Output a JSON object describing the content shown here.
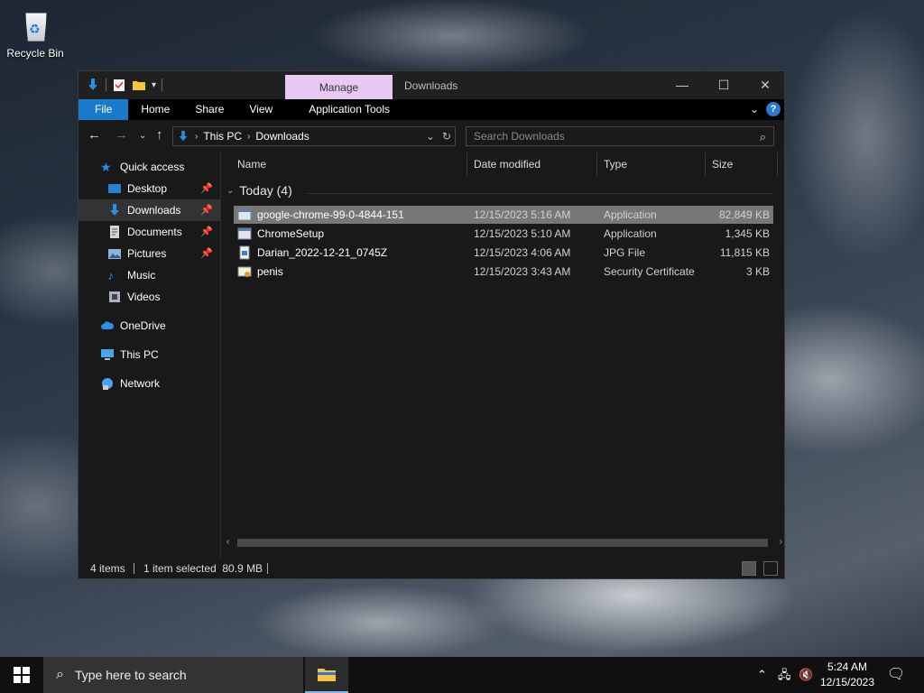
{
  "desktop": {
    "recycle_bin_label": "Recycle Bin"
  },
  "window": {
    "ribbon_context_tab": "Manage",
    "title": "Downloads",
    "controls": {
      "minimize": "—",
      "maximize": "☐",
      "close": "✕"
    },
    "ribbon_tabs": [
      "File",
      "Home",
      "Share",
      "View",
      "Application Tools"
    ],
    "address": {
      "crumbs": [
        "This PC",
        "Downloads"
      ]
    },
    "search": {
      "placeholder": "Search Downloads"
    }
  },
  "sidebar": {
    "items": [
      {
        "label": "Quick access",
        "icon": "star-icon",
        "color": "#2e8ae6"
      },
      {
        "label": "Desktop",
        "icon": "desktop-icon",
        "color": "#2b7fd4",
        "pinned": true
      },
      {
        "label": "Downloads",
        "icon": "download-icon",
        "color": "#2b8fe8",
        "pinned": true,
        "active": true
      },
      {
        "label": "Documents",
        "icon": "documents-icon",
        "color": "#cfd6de",
        "pinned": true
      },
      {
        "label": "Pictures",
        "icon": "pictures-icon",
        "color": "#8fb3d6",
        "pinned": true
      },
      {
        "label": "Music",
        "icon": "music-icon",
        "color": "#2e8ae6"
      },
      {
        "label": "Videos",
        "icon": "videos-icon",
        "color": "#aab4c0"
      },
      {
        "label": "OneDrive",
        "icon": "cloud-icon",
        "color": "#2b8fe8"
      },
      {
        "label": "This PC",
        "icon": "computer-icon",
        "color": "#4aa3ef"
      },
      {
        "label": "Network",
        "icon": "network-icon",
        "color": "#4aa3ef"
      }
    ]
  },
  "files": {
    "columns": [
      "Name",
      "Date modified",
      "Type",
      "Size"
    ],
    "group_label": "Today (4)",
    "rows": [
      {
        "name": "google-chrome-99-0-4844-151",
        "date": "12/15/2023 5:16 AM",
        "type": "Application",
        "size": "82,849 KB",
        "icon": "application-icon",
        "selected": true
      },
      {
        "name": "ChromeSetup",
        "date": "12/15/2023 5:10 AM",
        "type": "Application",
        "size": "1,345 KB",
        "icon": "application-icon"
      },
      {
        "name": "Darian_2022-12-21_0745Z",
        "date": "12/15/2023 4:06 AM",
        "type": "JPG File",
        "size": "11,815 KB",
        "icon": "image-file-icon"
      },
      {
        "name": "penis",
        "date": "12/15/2023 3:43 AM",
        "type": "Security Certificate",
        "size": "3 KB",
        "icon": "certificate-icon"
      }
    ]
  },
  "status": {
    "items_count": "4 items",
    "selection": "1 item selected  80.9 MB"
  },
  "taskbar": {
    "search_placeholder": "Type here to search",
    "time": "5:24 AM",
    "date": "12/15/2023"
  }
}
